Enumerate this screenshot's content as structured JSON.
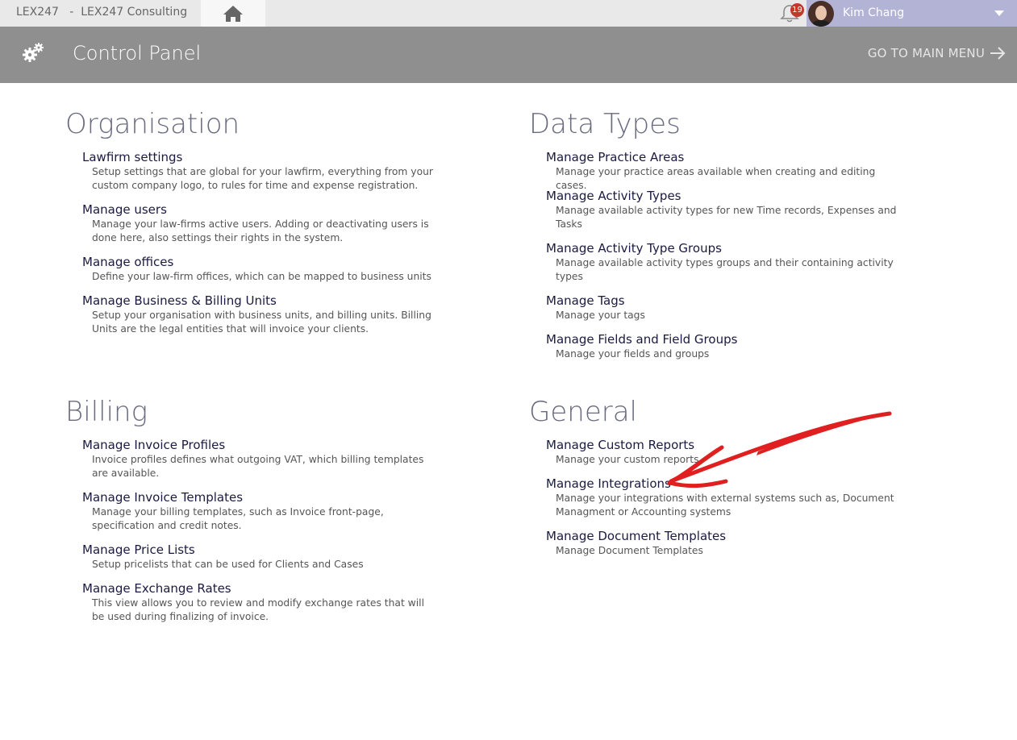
{
  "topbar": {
    "app_title": "LEX247   -  LEX247 Consulting",
    "notifications_count": "19",
    "user_name": "Kim Chang"
  },
  "header": {
    "title": "Control Panel",
    "main_menu_label": "GO TO MAIN MENU"
  },
  "sections": {
    "organisation": {
      "title": "Organisation",
      "items": [
        {
          "title": "Lawfirm settings",
          "desc": "Setup settings that are global for your lawfirm, everything from your custom company logo, to rules for time and expense registration."
        },
        {
          "title": "Manage users",
          "desc": "Manage your law-firms active users. Adding or deactivating users is done here, also settings their rights in the system."
        },
        {
          "title": "Manage offices",
          "desc": "Define your law-firm offices, which can be mapped to business units"
        },
        {
          "title": "Manage Business & Billing Units",
          "desc": "Setup your organisation with business units, and billing units. Billing Units are the legal entities that will invoice your clients."
        }
      ]
    },
    "data_types": {
      "title": "Data Types",
      "items": [
        {
          "title": "Manage Practice Areas",
          "desc": "Manage your practice areas available when creating and editing cases."
        },
        {
          "title": "Manage Activity Types",
          "desc": "Manage available activity types for new Time records, Expenses and Tasks"
        },
        {
          "title": "Manage Activity Type Groups",
          "desc": "Manage available activity types groups and their containing activity types"
        },
        {
          "title": "Manage Tags",
          "desc": "Manage your tags"
        },
        {
          "title": "Manage Fields and Field Groups",
          "desc": "Manage your fields and groups"
        }
      ]
    },
    "billing": {
      "title": "Billing",
      "items": [
        {
          "title": "Manage Invoice Profiles",
          "desc": "Invoice profiles defines what outgoing VAT, which billing templates are available."
        },
        {
          "title": "Manage Invoice Templates",
          "desc": "Manage your billing templates, such as Invoice front-page, specification and credit notes."
        },
        {
          "title": "Manage Price Lists",
          "desc": "Setup pricelists that can be used for Clients and Cases"
        },
        {
          "title": "Manage Exchange Rates",
          "desc": "This view allows you to review and modify exchange rates that will be used during finalizing of invoice."
        }
      ]
    },
    "general": {
      "title": "General",
      "items": [
        {
          "title": "Manage Custom Reports",
          "desc": "Manage your custom reports"
        },
        {
          "title": "Manage Integrations",
          "desc": "Manage your integrations with external systems such as, Document Managment or Accounting systems"
        },
        {
          "title": "Manage Document Templates",
          "desc": "Manage Document Templates"
        }
      ]
    }
  },
  "colors": {
    "header_bg": "#8f8f8f",
    "user_area_bg": "#b3b3d6",
    "annotation_arrow": "#e02020"
  }
}
